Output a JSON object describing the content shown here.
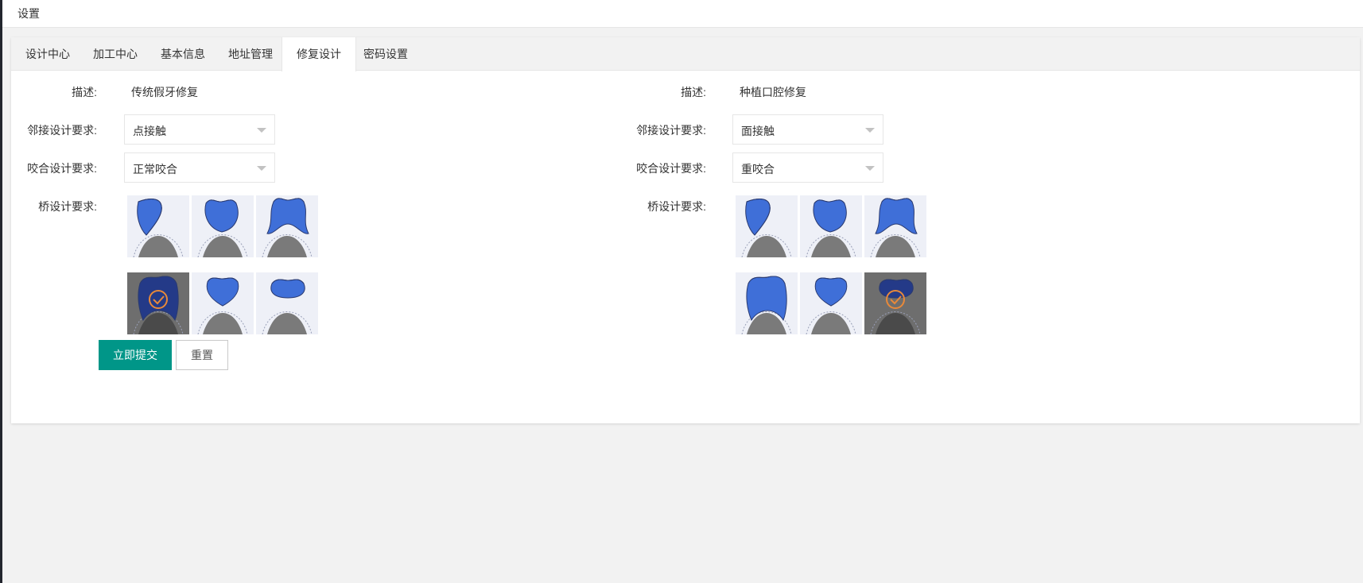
{
  "header": {
    "title": "设置"
  },
  "tabs": [
    {
      "label": "设计中心"
    },
    {
      "label": "加工中心"
    },
    {
      "label": "基本信息"
    },
    {
      "label": "地址管理"
    },
    {
      "label": "修复设计",
      "active": true
    },
    {
      "label": "密码设置"
    }
  ],
  "left": {
    "desc_label": "描述:",
    "desc_value": "传统假牙修复",
    "proximal_label": "邻接设计要求:",
    "proximal_value": "点接触",
    "occlusal_label": "咬合设计要求:",
    "occlusal_value": "正常咬合",
    "bridge_label": "桥设计要求:",
    "bridge_options": [
      {
        "shape": "tilted-crown",
        "selected": false
      },
      {
        "shape": "full-crown",
        "selected": false
      },
      {
        "shape": "saddle-crown",
        "selected": false
      },
      {
        "shape": "ridge-lap",
        "selected": true
      },
      {
        "shape": "bullet",
        "selected": false
      },
      {
        "shape": "hygienic",
        "selected": false
      }
    ]
  },
  "right": {
    "desc_label": "描述:",
    "desc_value": "种植口腔修复",
    "proximal_label": "邻接设计要求:",
    "proximal_value": "面接触",
    "occlusal_label": "咬合设计要求:",
    "occlusal_value": "重咬合",
    "bridge_label": "桥设计要求:",
    "bridge_options": [
      {
        "shape": "tilted-crown",
        "selected": false
      },
      {
        "shape": "full-crown",
        "selected": false
      },
      {
        "shape": "saddle-crown",
        "selected": false
      },
      {
        "shape": "ridge-lap",
        "selected": false
      },
      {
        "shape": "bullet",
        "selected": false
      },
      {
        "shape": "hygienic",
        "selected": true
      }
    ]
  },
  "actions": {
    "submit_label": "立即提交",
    "reset_label": "重置"
  },
  "colors": {
    "primary": "#009688",
    "tooth_blue": "#3f6fd8",
    "check_orange": "#e8893a"
  }
}
